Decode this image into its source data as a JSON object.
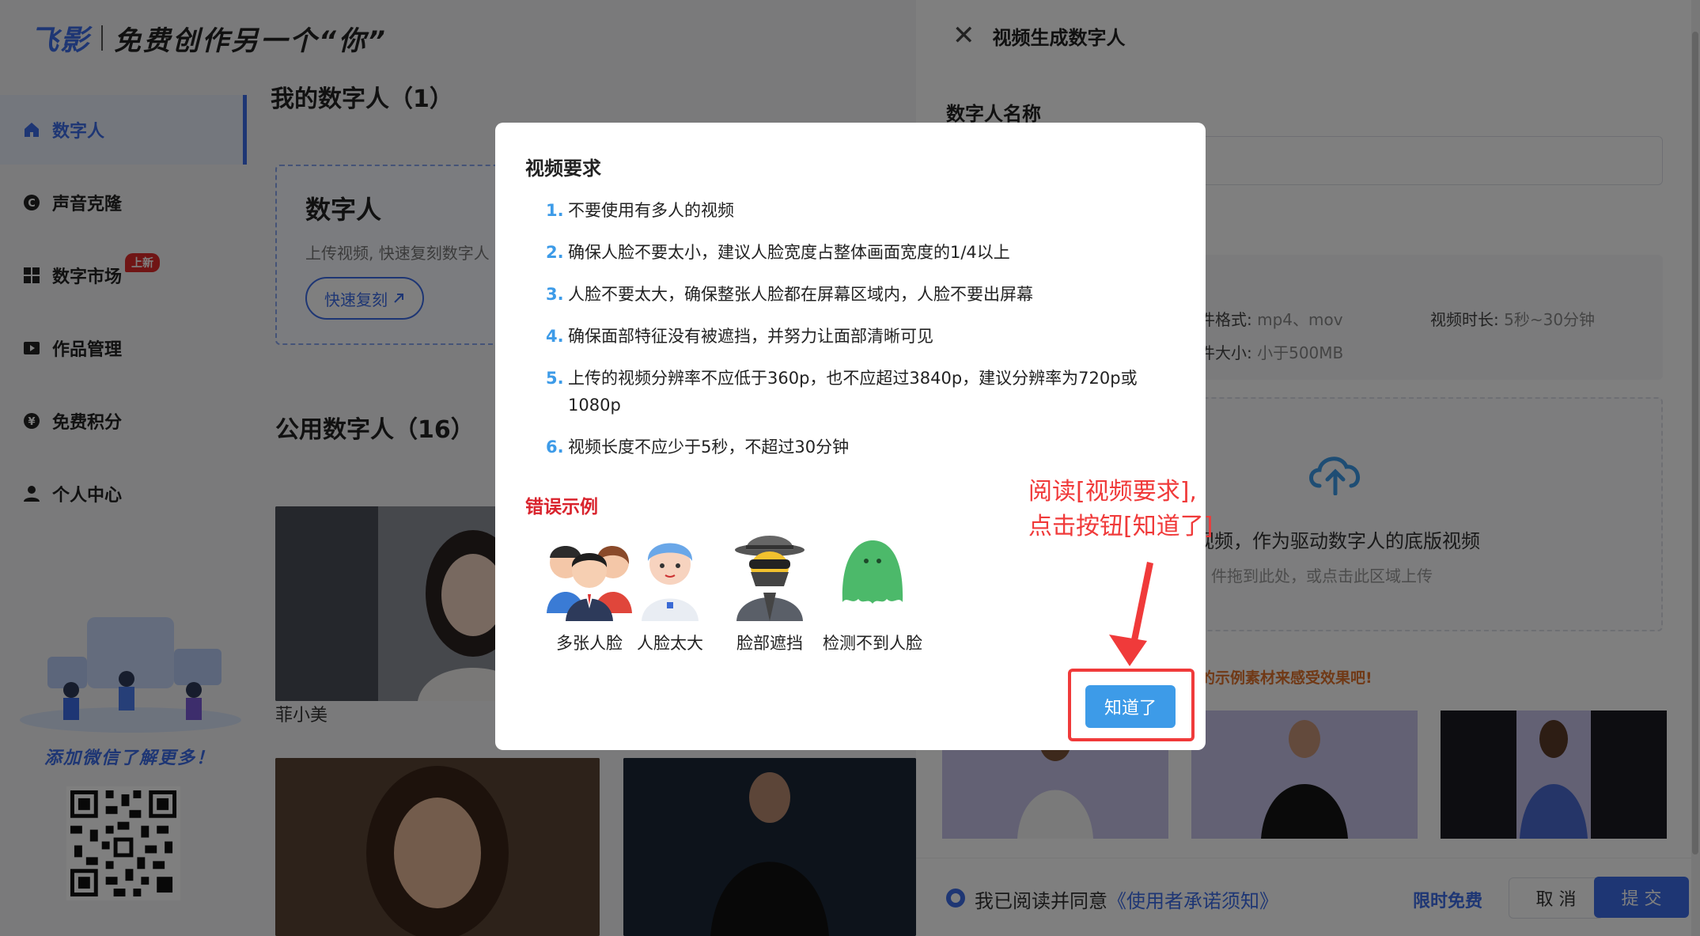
{
  "brand": {
    "logo": "飞影",
    "slogan": "免费创作另一个“你”"
  },
  "sidebar": {
    "items": [
      {
        "label": "数字人",
        "icon": "home-icon",
        "active": true
      },
      {
        "label": "声音克隆",
        "icon": "copyright-icon",
        "active": false
      },
      {
        "label": "数字市场",
        "icon": "grid-icon",
        "active": false,
        "badge": "上新"
      },
      {
        "label": "作品管理",
        "icon": "video-icon",
        "active": false
      },
      {
        "label": "免费积分",
        "icon": "yen-icon",
        "active": false
      },
      {
        "label": "个人中心",
        "icon": "user-icon",
        "active": false
      }
    ],
    "promo_text": "添加微信了解更多！"
  },
  "main": {
    "my_title": "我的数字人（1）",
    "my_card": {
      "title": "数字人",
      "desc": "上传视频, 快速复刻数字人",
      "button": "快速复刻"
    },
    "public_title": "公用数字人（16）",
    "avatars": [
      {
        "name": "菲小美"
      }
    ]
  },
  "panel": {
    "title": "视频生成数字人",
    "name_label": "数字人名称",
    "requirements": {
      "format_key": "文件格式:",
      "format_val": "mp4、mov",
      "duration_key": "视频时长:",
      "duration_val": "5秒~30分钟",
      "size_key": "文件大小:",
      "size_val": "小于500MB"
    },
    "upload": {
      "main": "视频，作为驱动数字人的底版视频",
      "sub": "件拖到此处，或点击此区域上传"
    },
    "example_tip": "们的示例素材来感受效果吧!",
    "footer": {
      "agree": "我已阅读并同意",
      "agree_link": "《使用者承诺须知》",
      "limited": "限时免费",
      "cancel": "取 消",
      "submit": "提 交"
    }
  },
  "modal": {
    "title": "视频要求",
    "items": [
      {
        "num": "1.",
        "text": "不要使用有多人的视频"
      },
      {
        "num": "2.",
        "text": "确保人脸不要太小，建议人脸宽度占整体画面宽度的1/4以上"
      },
      {
        "num": "3.",
        "text": "人脸不要太大，确保整张人脸都在屏幕区域内，人脸不要出屏幕"
      },
      {
        "num": "4.",
        "text": "确保面部特征没有被遮挡，并努力让面部清晰可见"
      },
      {
        "num": "5.",
        "text": "上传的视频分辨率不应低于360p，也不应超过3840p，建议分辨率为720p或1080p"
      },
      {
        "num": "6.",
        "text": "视频长度不应少于5秒，不超过30分钟"
      }
    ],
    "error_title": "错误示例",
    "errors": [
      "多张人脸",
      "人脸太大",
      "脸部遮挡",
      "检测不到人脸"
    ],
    "ok_button": "知道了"
  },
  "annotation": {
    "line1": "阅读[视频要求],",
    "line2": "点击按钮[知道了]"
  }
}
